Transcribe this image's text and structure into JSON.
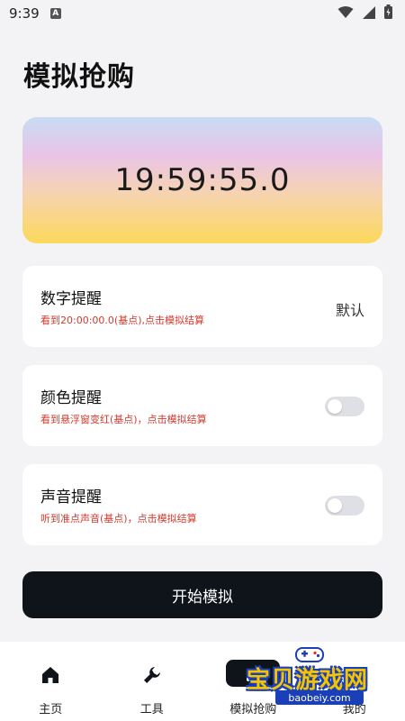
{
  "status_bar": {
    "time": "9:39",
    "notif_letter": "A"
  },
  "page": {
    "title": "模拟抢购"
  },
  "timer": {
    "display": "19:59:55.0"
  },
  "settings": [
    {
      "title": "数字提醒",
      "subtitle": "看到20:00:00.0(基点),点击模拟结算",
      "value": "默认"
    },
    {
      "title": "颜色提醒",
      "subtitle": "看到悬浮窗变红(基点)，点击模拟结算",
      "toggle_on": false
    },
    {
      "title": "声音提醒",
      "subtitle": "听到准点声音(基点)，点击模拟结算",
      "toggle_on": false
    }
  ],
  "actions": {
    "start_label": "开始模拟"
  },
  "bottom_nav": {
    "items": [
      {
        "label": "主页",
        "icon": "home-icon"
      },
      {
        "label": "工具",
        "icon": "wrench-icon"
      },
      {
        "label": "模拟抢购",
        "icon": "cart-icon",
        "active": true
      },
      {
        "label": "我的",
        "icon": "user-icon"
      }
    ]
  },
  "watermark": {
    "text": "宝贝游戏网",
    "url": "baobeiy.com"
  },
  "colors": {
    "accent_dark": "#0f141b",
    "hint_red": "#d23b2f",
    "card_bg": "#ffffff",
    "page_bg": "#f3f3f5"
  }
}
